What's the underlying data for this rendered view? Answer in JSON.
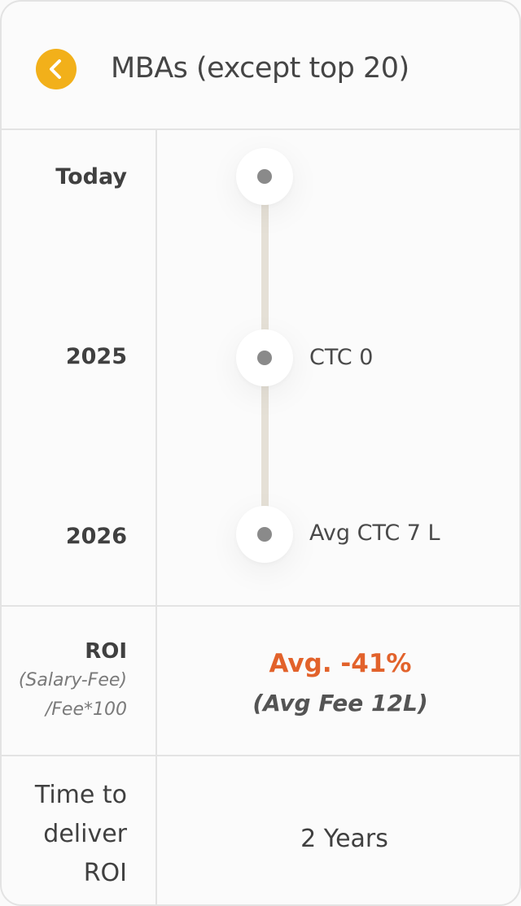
{
  "header": {
    "title": "MBAs (except top 20)",
    "back_icon": "chevron-left-icon",
    "accent_color": "#f2b01a"
  },
  "timeline": {
    "events": [
      {
        "year": "Today",
        "label": ""
      },
      {
        "year": "2025",
        "label": "CTC 0"
      },
      {
        "year": "2026",
        "label": "Avg CTC 7 L"
      }
    ]
  },
  "roi": {
    "label": "ROI",
    "formula_line1": "(Salary-Fee)",
    "formula_line2": "/Fee*100",
    "value": "Avg. -41%",
    "fee": "(Avg Fee 12L)",
    "value_color": "#e2622b"
  },
  "time_to_roi": {
    "label_line1": "Time to",
    "label_line2": "deliver",
    "label_line3": "ROI",
    "value": "2 Years"
  }
}
